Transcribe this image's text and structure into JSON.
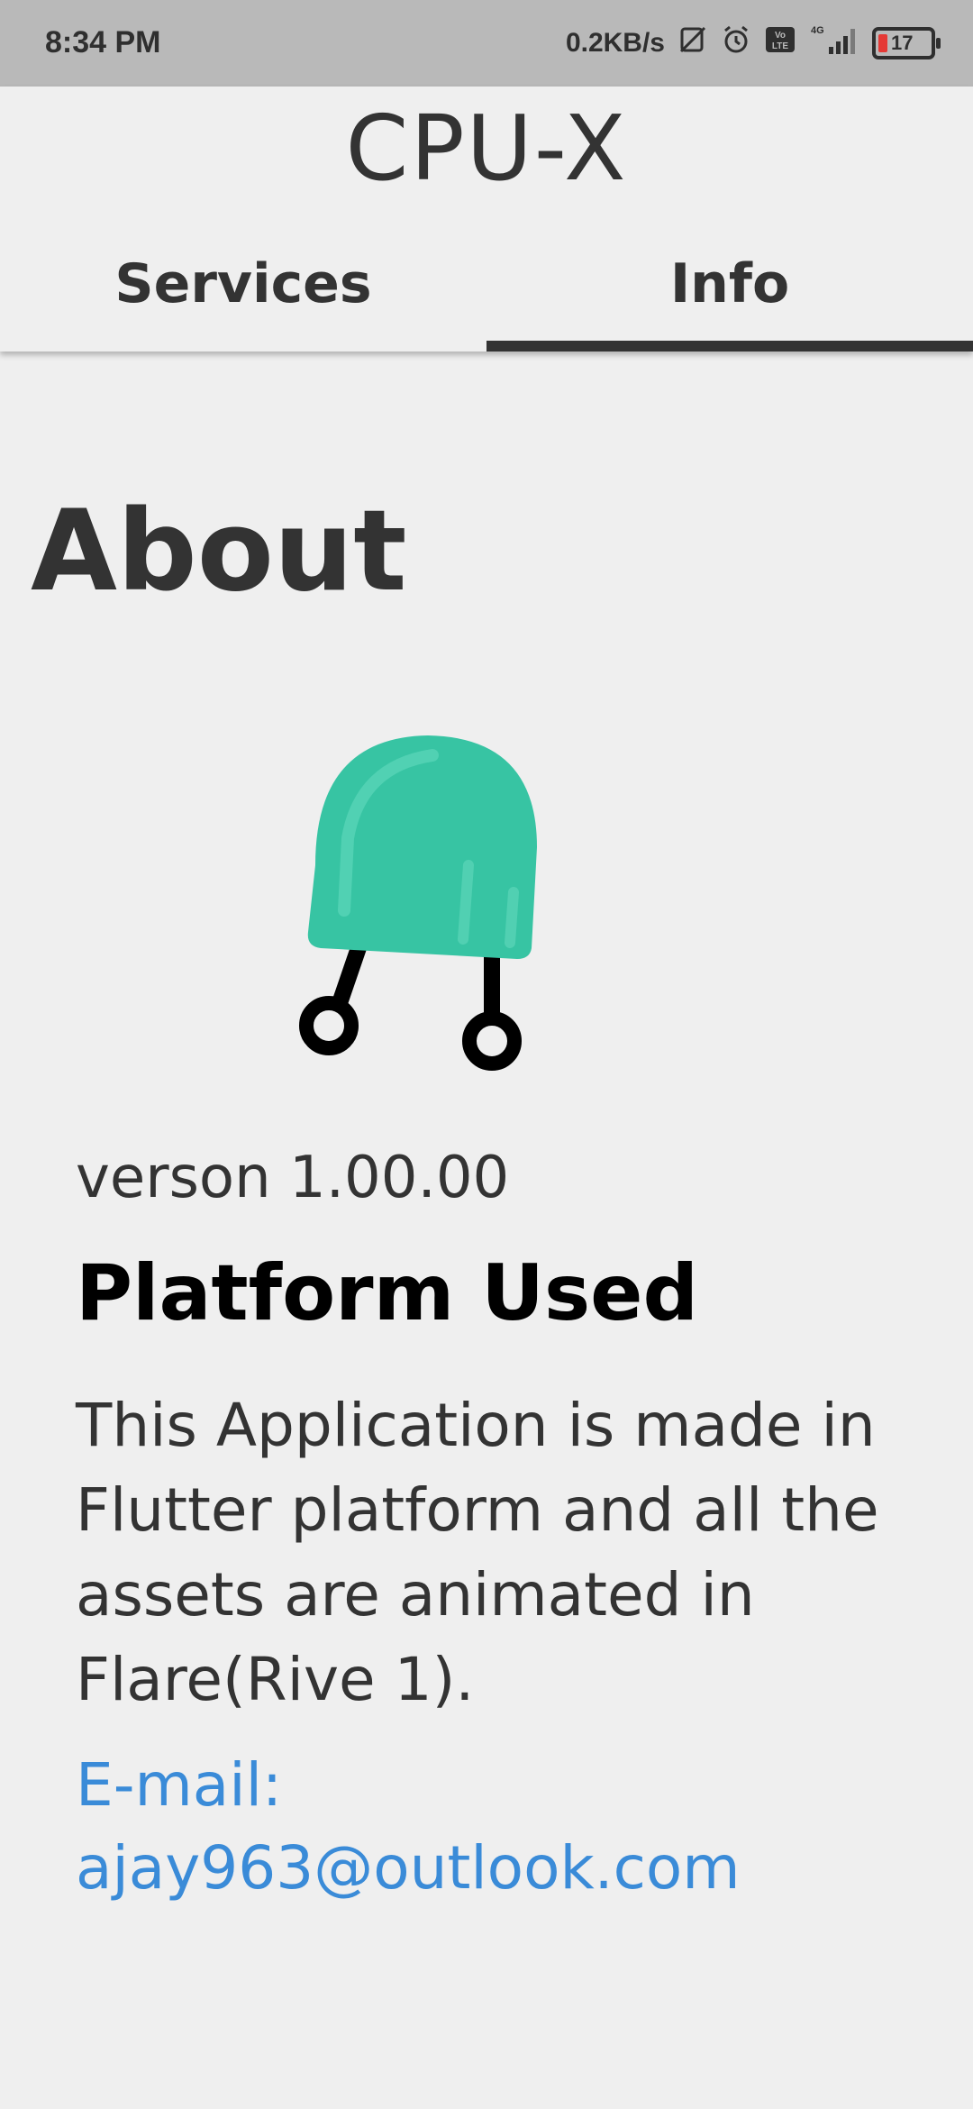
{
  "status_bar": {
    "time": "8:34 PM",
    "network_speed": "0.2KB/s",
    "icons": [
      "sim-disabled-icon",
      "alarm-icon",
      "volte-icon",
      "4g-signal-icon",
      "battery-icon"
    ],
    "network_type": "4G",
    "volte_label": "Vo LTE",
    "battery_level": "17"
  },
  "app_bar": {
    "title": "CPU-X",
    "tabs": [
      {
        "label": "Services",
        "active": false
      },
      {
        "label": "Info",
        "active": true
      }
    ]
  },
  "about": {
    "heading": "About",
    "illustration": "robot-icon",
    "illustration_color": "#37c4a3",
    "version": "verson 1.00.00",
    "platform_heading": "Platform Used",
    "description": "This Application is made in Flutter platform and all the assets are animated in Flare(Rive 1).",
    "email_label": "E-mail:",
    "email_value": "ajay963@outlook.com",
    "email_color": "#3a8bd8"
  }
}
